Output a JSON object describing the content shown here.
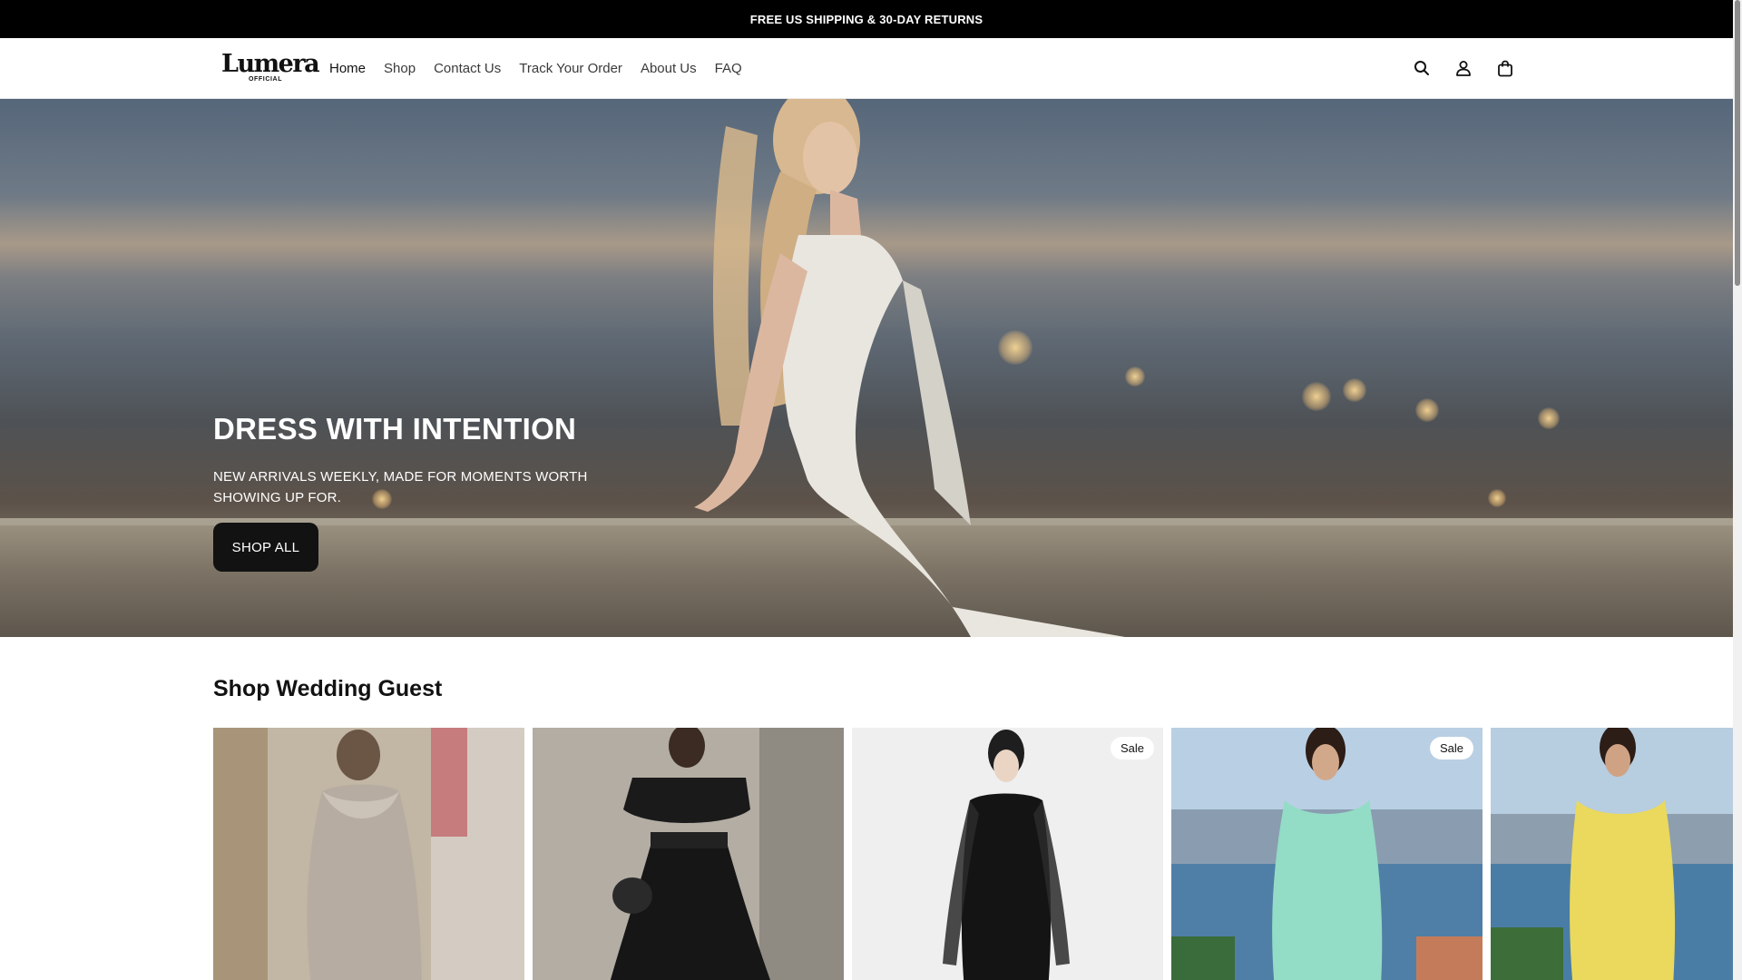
{
  "announcement": {
    "text": "FREE US SHIPPING & 30-DAY RETURNS"
  },
  "header": {
    "logo": {
      "wordmark": "Lumera",
      "sub": "OFFICIAL"
    },
    "nav": [
      {
        "label": "Home",
        "active": true
      },
      {
        "label": "Shop"
      },
      {
        "label": "Contact Us"
      },
      {
        "label": "Track Your Order"
      },
      {
        "label": "About Us"
      },
      {
        "label": "FAQ"
      }
    ],
    "icons": [
      "search-icon",
      "account-icon",
      "cart-icon"
    ]
  },
  "hero": {
    "title": "DRESS WITH INTENTION",
    "subtitle": "NEW ARRIVALS WEEKLY, MADE FOR MOMENTS WORTH SHOWING UP FOR.",
    "button": "SHOP ALL"
  },
  "collection": {
    "title": "Shop Wedding Guest",
    "products": [
      {
        "badge": "",
        "dress_color": "#b9ada1",
        "bg": "#b8ab98"
      },
      {
        "badge": "",
        "dress_color": "#141414",
        "bg": "#a39f98"
      },
      {
        "badge": "Sale",
        "dress_color": "#121212",
        "bg": "#eeeeef"
      },
      {
        "badge": "Sale",
        "dress_color": "#8fd8c3",
        "bg": "#9bb7d1"
      },
      {
        "badge": "",
        "dress_color": "#e9db62",
        "bg": "#9bb7d1"
      }
    ]
  },
  "colors": {
    "accent": "#121212",
    "announcement_bg": "#000000"
  }
}
